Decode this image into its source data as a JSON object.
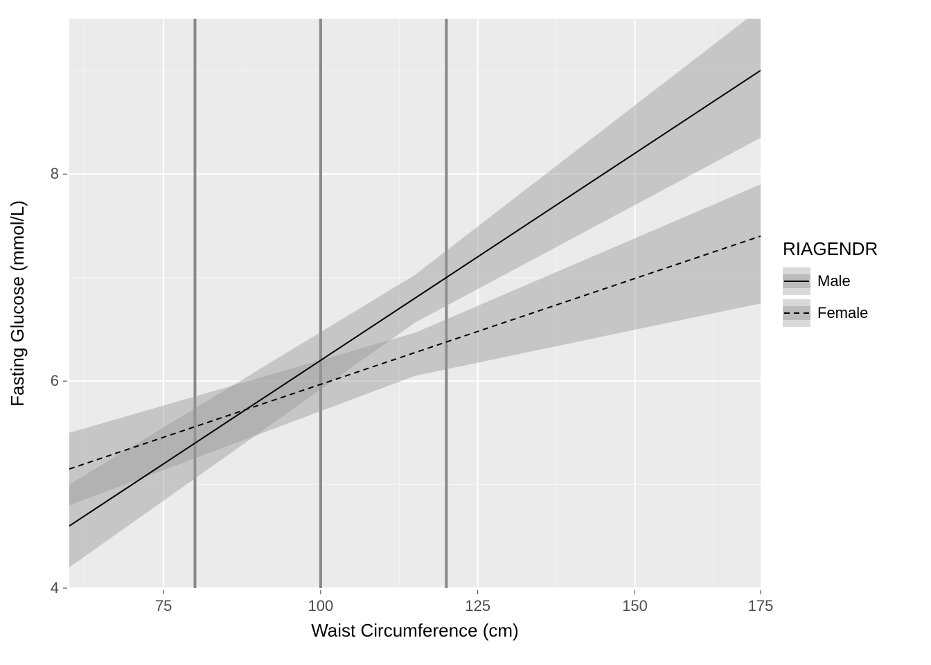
{
  "chart_data": {
    "type": "line",
    "xlabel": "Waist Circumference (cm)",
    "ylabel": "Fasting Glucose (mmol/L)",
    "xlim": [
      60,
      170
    ],
    "ylim": [
      4,
      9.5
    ],
    "x_ticks": [
      75,
      100,
      125,
      150,
      175
    ],
    "y_ticks": [
      4,
      6,
      8
    ],
    "vlines": [
      80,
      100,
      120
    ],
    "legend_title": "RIAGENDR",
    "series": [
      {
        "name": "Male",
        "linetype": "solid",
        "x": [
          60,
          170
        ],
        "y": [
          4.6,
          9.0
        ],
        "ci_lower": [
          4.2,
          8.35
        ],
        "ci_upper": [
          5.0,
          9.6
        ]
      },
      {
        "name": "Female",
        "linetype": "dashed",
        "x": [
          60,
          170
        ],
        "y": [
          5.15,
          7.4
        ],
        "ci_lower": [
          4.8,
          6.75
        ],
        "ci_upper": [
          5.5,
          7.9
        ]
      }
    ]
  },
  "legend": {
    "title": "RIAGENDR",
    "items": [
      {
        "label": "Male"
      },
      {
        "label": "Female"
      }
    ]
  },
  "axes": {
    "x_title": "Waist Circumference (cm)",
    "y_title": "Fasting Glucose (mmol/L)"
  }
}
